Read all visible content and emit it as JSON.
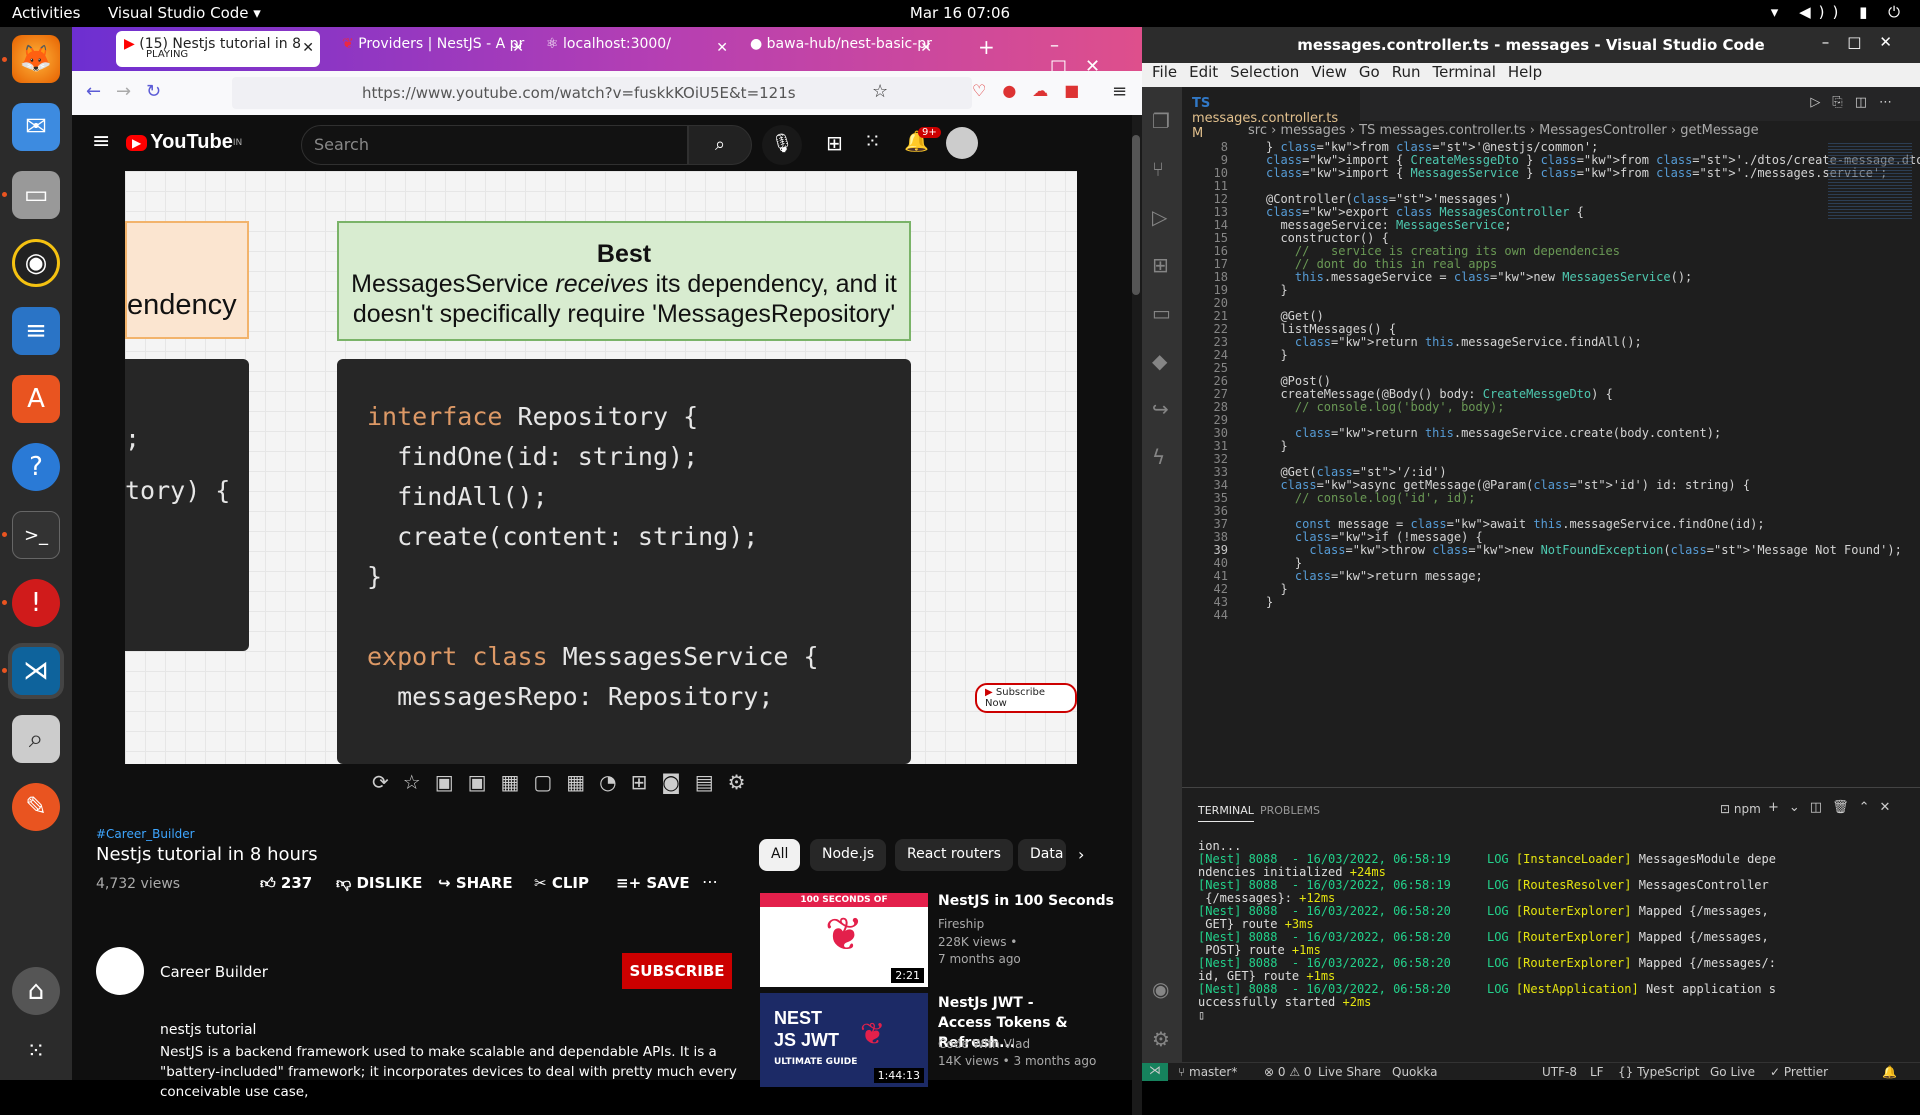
{
  "topbar": {
    "activities": "Activities",
    "app": "Visual Studio Code ▾",
    "clock": "Mar 16  07:06"
  },
  "browser": {
    "tabs": [
      {
        "title": "(15) Nestjs tutorial in 8",
        "sub": "PLAYING"
      },
      {
        "title": "Providers | NestJS - A pr"
      },
      {
        "title": "localhost:3000/"
      },
      {
        "title": "bawa-hub/nest-basic-pr"
      }
    ],
    "url": "https://www.youtube.com/watch?v=fuskkKOiU5E&t=121s"
  },
  "youtube": {
    "logo": "YouTube",
    "country": "IN",
    "search_placeholder": "Search",
    "notif_count": "9+",
    "slide": {
      "left_text": "endency",
      "best_title": "Best",
      "best_body_1": "MessagesService ",
      "best_body_em": "receives",
      "best_body_2": " its dependency, and it doesn't specifically require 'MessagesRepository'",
      "left_code": [
        ";",
        "tory) {"
      ],
      "code": [
        "interface Repository {",
        "  findOne(id: string);",
        "  findAll();",
        "  create(content: string);",
        "}",
        "",
        "export class MessagesService {",
        "  messagesRepo: Repository;"
      ],
      "subscribe_now": "Subscribe Now"
    },
    "hashtag": "#Career_Builder",
    "title": "Nestjs tutorial in 8 hours",
    "views": "4,732 views",
    "likes": "237",
    "dislike": "DISLIKE",
    "share": "SHARE",
    "clip": "CLIP",
    "save": "SAVE",
    "channel": "Career Builder",
    "subscribe": "SUBSCRIBE",
    "desc_title": "nestjs tutorial",
    "desc": "NestJS is a backend framework used to make scalable and dependable APIs. It is a \"battery-included\" framework; it incorporates devices to deal with pretty much every conceivable use case,",
    "chips": [
      "All",
      "Node.js",
      "React routers",
      "Data"
    ],
    "recs": [
      {
        "title": "NestJS in 100 Seconds",
        "channel": "Fireship",
        "meta1": "228K views •",
        "meta2": "7 months ago",
        "duration": "2:21",
        "thumb_label": "100 SECONDS OF"
      },
      {
        "title": "NestJs JWT - Access Tokens & Refresh...",
        "channel": "Code With Vlad",
        "meta1": "14K views • 3 months ago",
        "duration": "1:44:13",
        "thumb_label": "NEST JS JWT",
        "thumb_sub": "ULTIMATE GUIDE"
      }
    ]
  },
  "vscode": {
    "title": "messages.controller.ts - messages - Visual Studio Code",
    "menu": [
      "File",
      "Edit",
      "Selection",
      "View",
      "Go",
      "Run",
      "Terminal",
      "Help"
    ],
    "tab": {
      "lang": "TS",
      "name": "messages.controller.ts",
      "badge": "M"
    },
    "breadcrumb": [
      "src",
      "messages",
      "TS messages.controller.ts",
      "MessagesController",
      "getMessage"
    ],
    "code_lines": [
      {
        "n": "8",
        "t": "} from '@nestjs/common';"
      },
      {
        "n": "9",
        "t": "import { CreateMessgeDto } from './dtos/create-message.dto';"
      },
      {
        "n": "10",
        "t": "import { MessagesService } from './messages.service';"
      },
      {
        "n": "11",
        "t": ""
      },
      {
        "n": "12",
        "t": "@Controller('messages')"
      },
      {
        "n": "13",
        "t": "export class MessagesController {"
      },
      {
        "n": "14",
        "t": "  messageService: MessagesService;"
      },
      {
        "n": "15",
        "t": "  constructor() {"
      },
      {
        "n": "16",
        "t": "    //   service is creating its own dependencies"
      },
      {
        "n": "17",
        "t": "    // dont do this in real apps"
      },
      {
        "n": "18",
        "t": "    this.messageService = new MessagesService();"
      },
      {
        "n": "19",
        "t": "  }"
      },
      {
        "n": "20",
        "t": ""
      },
      {
        "n": "21",
        "t": "  @Get()"
      },
      {
        "n": "22",
        "t": "  listMessages() {"
      },
      {
        "n": "23",
        "t": "    return this.messageService.findAll();"
      },
      {
        "n": "24",
        "t": "  }"
      },
      {
        "n": "25",
        "t": ""
      },
      {
        "n": "26",
        "t": "  @Post()"
      },
      {
        "n": "27",
        "t": "  createMessage(@Body() body: CreateMessgeDto) {"
      },
      {
        "n": "28",
        "t": "    // console.log('body', body);"
      },
      {
        "n": "29",
        "t": ""
      },
      {
        "n": "30",
        "t": "    return this.messageService.create(body.content);"
      },
      {
        "n": "31",
        "t": "  }"
      },
      {
        "n": "32",
        "t": ""
      },
      {
        "n": "33",
        "t": "  @Get('/:id')"
      },
      {
        "n": "34",
        "t": "  async getMessage(@Param('id') id: string) {"
      },
      {
        "n": "35",
        "t": "    // console.log('id', id);"
      },
      {
        "n": "36",
        "t": ""
      },
      {
        "n": "37",
        "t": "    const message = await this.messageService.findOne(id);"
      },
      {
        "n": "38",
        "t": "    if (!message) {"
      },
      {
        "n": "39",
        "t": "      throw new NotFoundException('Message Not Found');"
      },
      {
        "n": "40",
        "t": "    }"
      },
      {
        "n": "41",
        "t": "    return message;"
      },
      {
        "n": "42",
        "t": "  }"
      },
      {
        "n": "43",
        "t": "}"
      },
      {
        "n": "44",
        "t": ""
      }
    ],
    "panel_tabs": [
      "TERMINAL",
      "PROBLEMS"
    ],
    "terminal_shell": "npm",
    "terminal_lines": [
      "ion...",
      "[Nest] 8088  - 16/03/2022, 06:58:19     LOG [InstanceLoader] MessagesModule depe",
      "ndencies initialized +24ms",
      "[Nest] 8088  - 16/03/2022, 06:58:19     LOG [RoutesResolver] MessagesController",
      " {/messages}: +12ms",
      "[Nest] 8088  - 16/03/2022, 06:58:20     LOG [RouterExplorer] Mapped {/messages,",
      " GET} route +3ms",
      "[Nest] 8088  - 16/03/2022, 06:58:20     LOG [RouterExplorer] Mapped {/messages,",
      " POST} route +1ms",
      "[Nest] 8088  - 16/03/2022, 06:58:20     LOG [RouterExplorer] Mapped {/messages/:",
      "id, GET} route +1ms",
      "[Nest] 8088  - 16/03/2022, 06:58:20     LOG [NestApplication] Nest application s",
      "uccessfully started +2ms",
      "▯"
    ],
    "status": {
      "branch": "master*",
      "problems": "⊗ 0 ⚠ 0",
      "liveshare": "Live Share",
      "quokka": "Quokka",
      "encoding": "UTF-8",
      "eol": "LF",
      "lang": "{} TypeScript",
      "golive": "Go Live",
      "prettier": "✓ Prettier"
    }
  }
}
